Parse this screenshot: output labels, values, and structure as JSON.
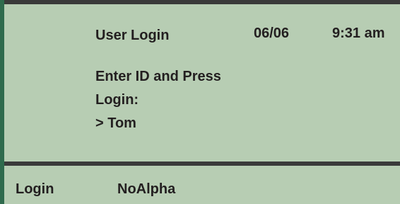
{
  "header": {
    "title": "User Login",
    "date": "06/06",
    "time": "9:31 am"
  },
  "prompt": {
    "line1": "Enter ID and Press",
    "line2": "Login:"
  },
  "entry": {
    "value": "> Tom"
  },
  "softkeys": [
    {
      "label": "Login"
    },
    {
      "label": "NoAlpha"
    }
  ],
  "colors": {
    "screen_background": "#b7cdb3",
    "text": "#231f20",
    "bezel": "#2f6b4d",
    "rules": "#3a3a3a"
  }
}
